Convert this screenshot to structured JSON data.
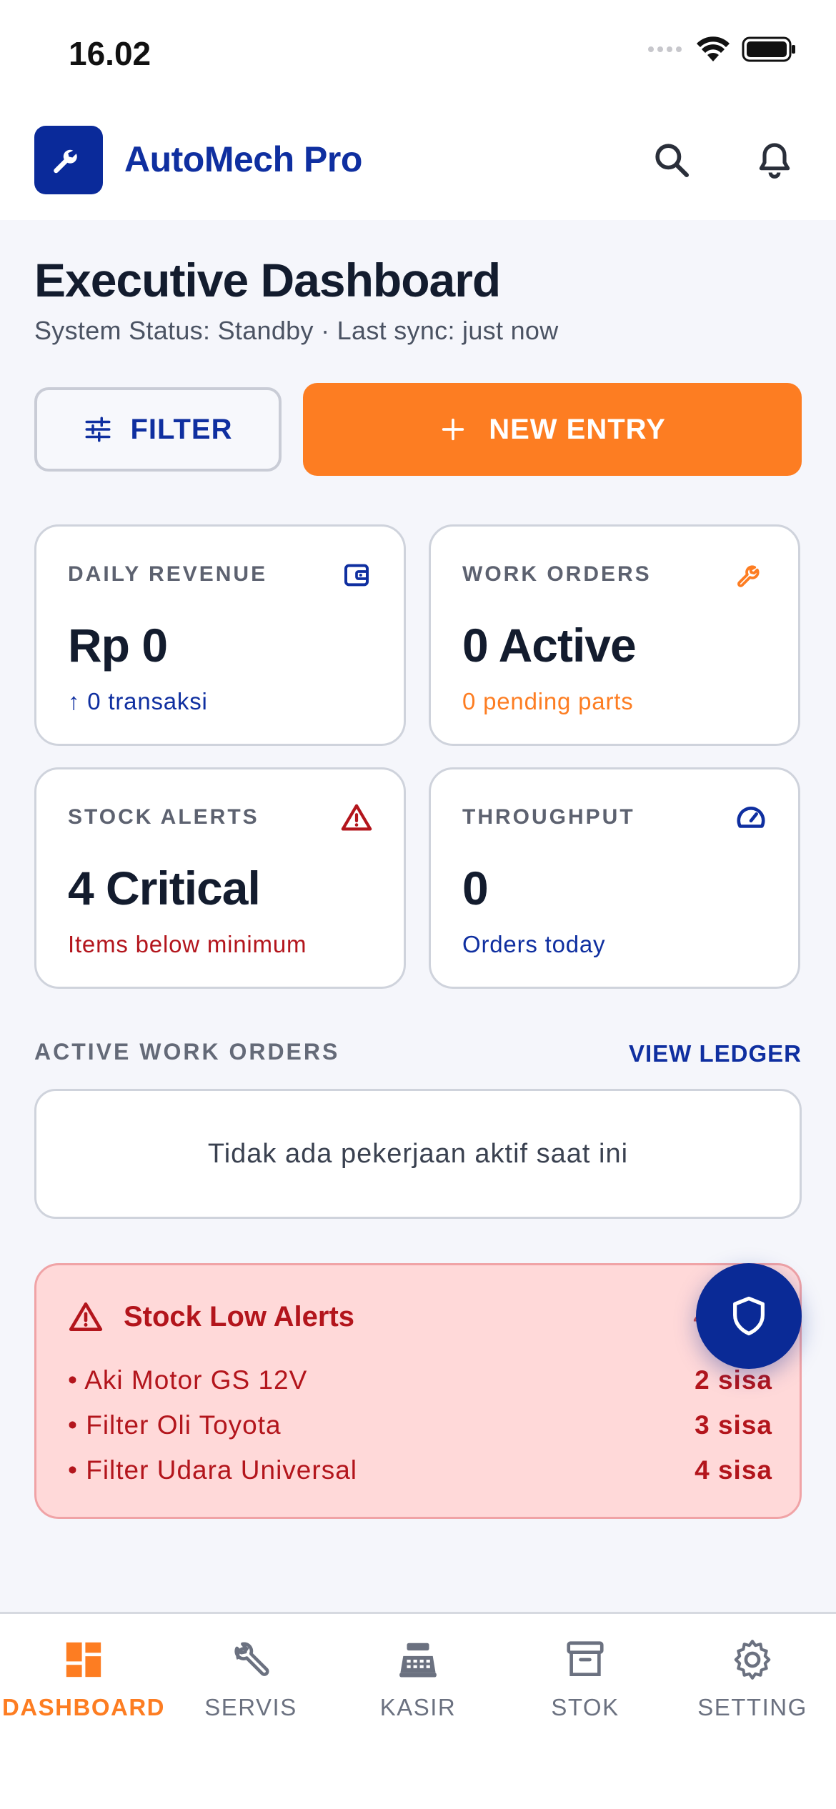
{
  "status_bar": {
    "time": "16.02"
  },
  "header": {
    "app_title": "AutoMech Pro"
  },
  "page": {
    "title": "Executive Dashboard",
    "subtitle": "System Status: Standby · Last sync: just now"
  },
  "actions": {
    "filter_label": "FILTER",
    "new_entry_label": "NEW ENTRY"
  },
  "cards": [
    {
      "label": "DAILY REVENUE",
      "value": "Rp 0",
      "note": "0 transaksi",
      "note_color": "#0f2fa0",
      "icon": "wallet-icon"
    },
    {
      "label": "WORK ORDERS",
      "value": "0 Active",
      "note": "0 pending parts",
      "note_color": "#fd7d22",
      "icon": "wrench-icon"
    },
    {
      "label": "STOCK ALERTS",
      "value": "4 Critical",
      "note": "Items below minimum",
      "note_color": "#b3151c",
      "icon": "warning-icon"
    },
    {
      "label": "THROUGHPUT",
      "value": "0",
      "note": "Orders today",
      "note_color": "#0f2fa0",
      "icon": "speedometer-icon"
    }
  ],
  "work_orders": {
    "heading": "ACTIVE WORK ORDERS",
    "view_ledger": "VIEW LEDGER",
    "empty_text": "Tidak ada pekerjaan aktif saat ini"
  },
  "stock_alerts": {
    "title": "Stock Low Alerts",
    "count": "4",
    "items": [
      {
        "name": "• Aki Motor GS 12V",
        "qty": "2 sisa"
      },
      {
        "name": "• Filter Oli Toyota",
        "qty": "3 sisa"
      },
      {
        "name": "• Filter Udara Universal",
        "qty": "4 sisa"
      }
    ]
  },
  "tabbar": {
    "items": [
      {
        "label": "DASHBOARD",
        "icon": "dashboard-grid-icon",
        "active": true
      },
      {
        "label": "SERVIS",
        "icon": "tools-icon",
        "active": false
      },
      {
        "label": "KASIR",
        "icon": "cash-register-icon",
        "active": false
      },
      {
        "label": "STOK",
        "icon": "archive-box-icon",
        "active": false
      },
      {
        "label": "SETTING",
        "icon": "gear-icon",
        "active": false
      }
    ]
  },
  "colors": {
    "brand_blue": "#0f2fa0",
    "accent_orange": "#fd7d22",
    "alert_red": "#b3151c",
    "alert_bg": "#ffd9d9"
  }
}
